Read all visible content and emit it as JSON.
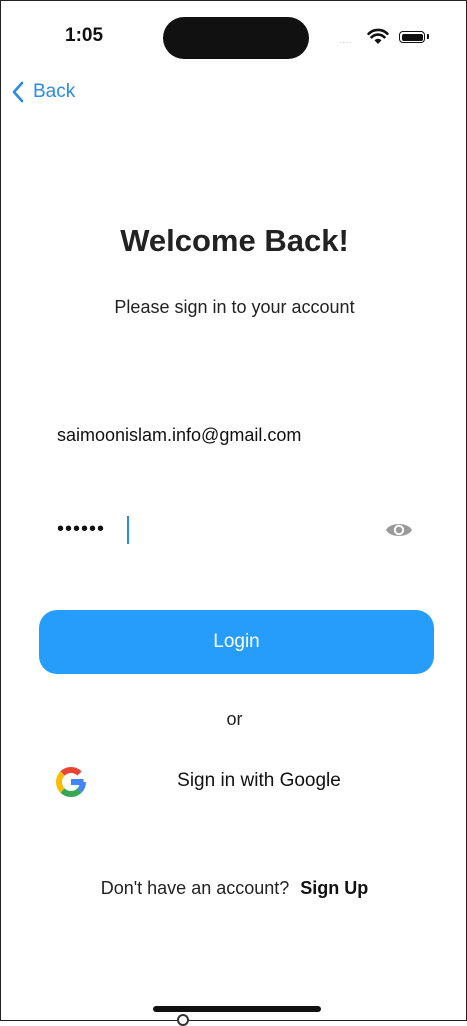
{
  "status_bar": {
    "time": "1:05",
    "signal_dots": "....",
    "wifi_icon": "wifi-icon",
    "battery_icon": "battery-icon"
  },
  "nav": {
    "back_label": "Back",
    "accent_color": "#2a8be8"
  },
  "header": {
    "title": "Welcome Back!",
    "subtitle": "Please sign in to your account"
  },
  "form": {
    "email_value": "saimoonislam.info@gmail.com",
    "password_value": "••••••",
    "show_password_icon": "eye-icon"
  },
  "actions": {
    "login_label": "Login",
    "login_color": "#269dfb",
    "or_label": "or",
    "google_label": "Sign in with Google",
    "google_icon": "google-logo-icon"
  },
  "footer": {
    "prompt": "Don't have an account?",
    "signup_label": "Sign Up"
  }
}
